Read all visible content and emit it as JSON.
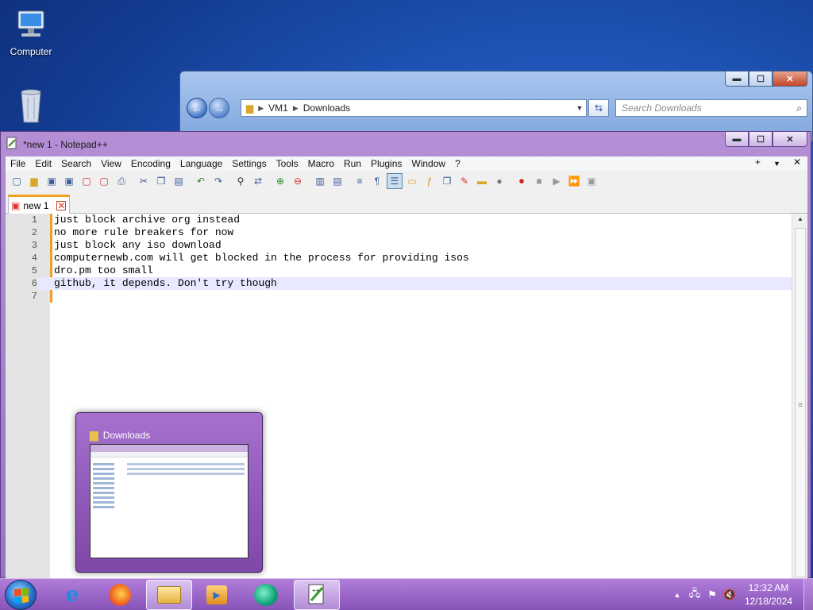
{
  "desktop": {
    "icons": [
      {
        "label": "Computer",
        "icon": "computer-icon"
      },
      {
        "label": "Recycle Bin",
        "icon": "recycle-bin-icon"
      }
    ]
  },
  "explorer": {
    "path_root": "VM1",
    "path_folder": "Downloads",
    "search_placeholder": "Search Downloads",
    "controls": {
      "minimize": "▬",
      "maximize": "☐",
      "close": "✕"
    }
  },
  "notepad": {
    "title": "*new 1 - Notepad++",
    "menu": [
      "File",
      "Edit",
      "Search",
      "View",
      "Encoding",
      "Language",
      "Settings",
      "Tools",
      "Macro",
      "Run",
      "Plugins",
      "Window",
      "?"
    ],
    "menu_right": {
      "plus": "+",
      "down": "▼",
      "close": "✕"
    },
    "tab_label": "new 1",
    "lines": [
      {
        "num": "1",
        "text": "just block archive org instead"
      },
      {
        "num": "2",
        "text": "no more rule breakers for now"
      },
      {
        "num": "3",
        "text": "just block any iso download"
      },
      {
        "num": "4",
        "text": "computernewb.com will get blocked in the process for providing isos"
      },
      {
        "num": "5",
        "text": "dro.pm too small"
      },
      {
        "num": "6",
        "text": "github, it depends. Don't try though"
      },
      {
        "num": "7",
        "text": ""
      }
    ],
    "active_line": 6
  },
  "thumbnail": {
    "title": "Downloads"
  },
  "taskbar": {
    "apps": [
      "internet-explorer-icon",
      "firefox-icon",
      "file-explorer-icon",
      "media-player-icon",
      "chat-icon",
      "notepad-plus-plus-icon"
    ],
    "clock_time": "12:32 AM",
    "clock_date": "12/18/2024"
  },
  "colors": {
    "window_accent": "#a67ad0",
    "taskbar": "#9a68c8",
    "desktop": "#1f55b8"
  }
}
